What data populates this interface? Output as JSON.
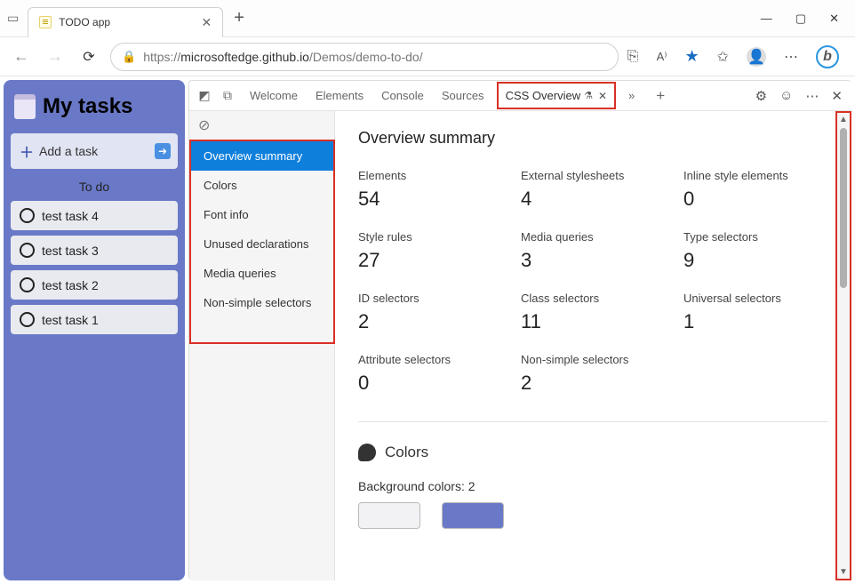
{
  "browser": {
    "tab_title": "TODO app",
    "url_prefix": "https://",
    "url_host": "microsoftedge.github.io",
    "url_path": "/Demos/demo-to-do/"
  },
  "app": {
    "title": "My tasks",
    "add_task_label": "Add a task",
    "todo_label": "To do",
    "tasks": [
      "test task 4",
      "test task 3",
      "test task 2",
      "test task 1"
    ]
  },
  "devtools": {
    "tabs": [
      "Welcome",
      "Elements",
      "Console",
      "Sources"
    ],
    "active_tab": "CSS Overview",
    "sidebar": [
      "Overview summary",
      "Colors",
      "Font info",
      "Unused declarations",
      "Media queries",
      "Non-simple selectors"
    ],
    "overview": {
      "heading": "Overview summary",
      "stats": [
        {
          "label": "Elements",
          "value": "54"
        },
        {
          "label": "External stylesheets",
          "value": "4"
        },
        {
          "label": "Inline style elements",
          "value": "0"
        },
        {
          "label": "Style rules",
          "value": "27"
        },
        {
          "label": "Media queries",
          "value": "3"
        },
        {
          "label": "Type selectors",
          "value": "9"
        },
        {
          "label": "ID selectors",
          "value": "2"
        },
        {
          "label": "Class selectors",
          "value": "11"
        },
        {
          "label": "Universal selectors",
          "value": "1"
        },
        {
          "label": "Attribute selectors",
          "value": "0"
        },
        {
          "label": "Non-simple selectors",
          "value": "2"
        }
      ]
    },
    "colors": {
      "heading": "Colors",
      "bg_label": "Background colors: 2",
      "swatches": [
        "#f2f2f5",
        "#6a79c7"
      ]
    }
  }
}
